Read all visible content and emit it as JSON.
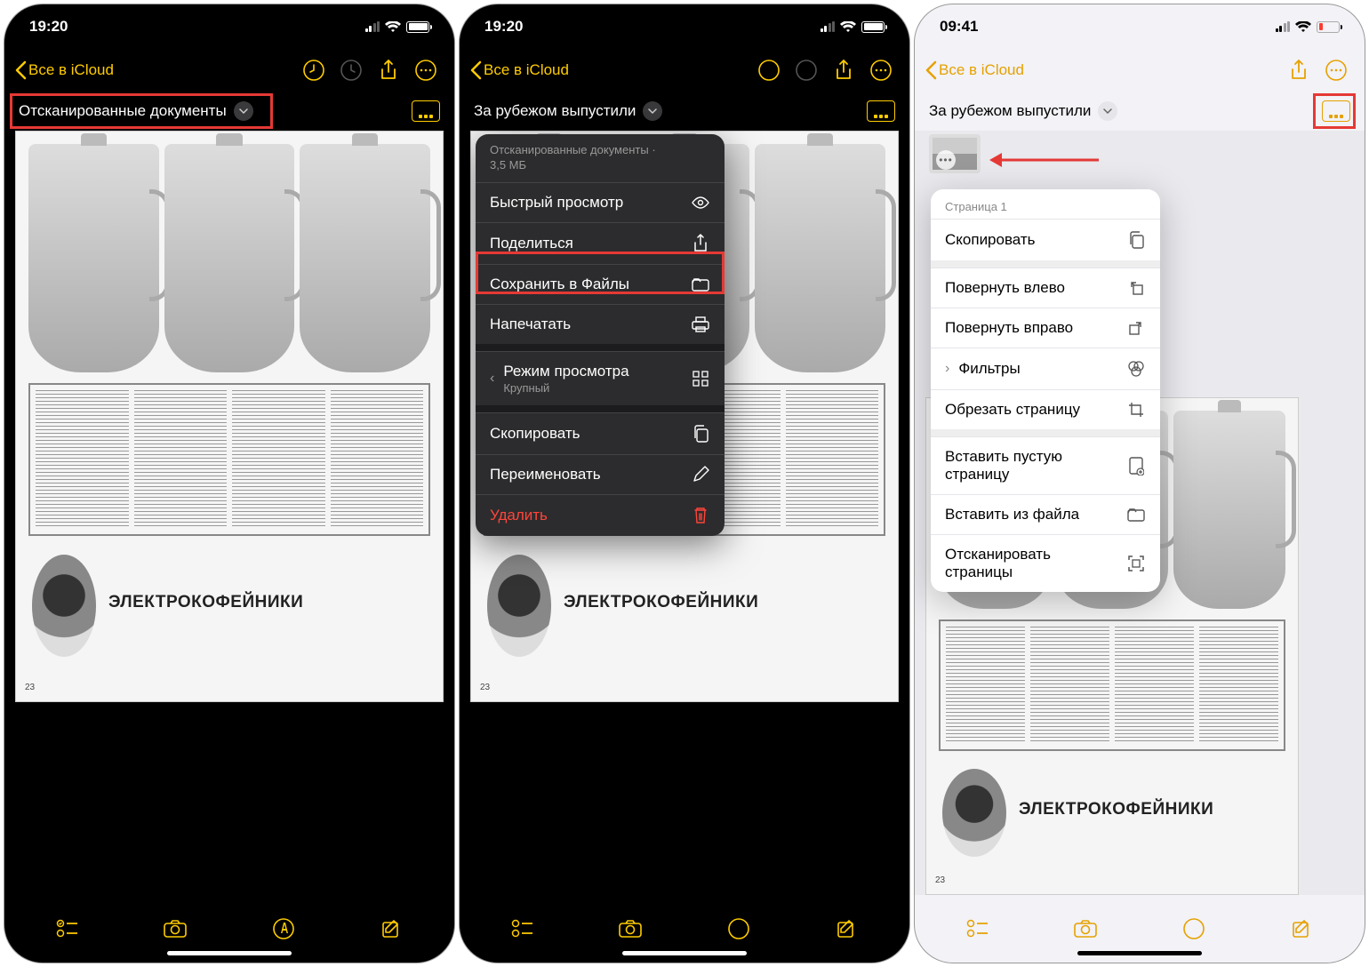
{
  "accent_dark": "#ffcc00",
  "accent_light": "#e6a100",
  "screen1": {
    "time": "19:20",
    "back": "Все в iCloud",
    "title": "Отсканированные документы"
  },
  "screen2": {
    "time": "19:20",
    "back": "Все в iCloud",
    "title": "За рубежом выпустили",
    "menu": {
      "header": "Отсканированные документы ·",
      "size": "3,5 МБ",
      "quicklook": "Быстрый просмотр",
      "share": "Поделиться",
      "save": "Сохранить в Файлы",
      "print": "Напечатать",
      "viewmode": "Режим просмотра",
      "viewmode_sub": "Крупный",
      "copy": "Скопировать",
      "rename": "Переименовать",
      "delete": "Удалить"
    }
  },
  "screen3": {
    "time": "09:41",
    "back": "Все в iCloud",
    "title": "За рубежом выпустили",
    "menu": {
      "header": "Страница 1",
      "copy": "Скопировать",
      "rotleft": "Повернуть влево",
      "rotright": "Повернуть вправо",
      "filters": "Фильтры",
      "crop": "Обрезать страницу",
      "insert_blank": "Вставить пустую страницу",
      "insert_file": "Вставить из файла",
      "scan": "Отсканировать страницы"
    }
  },
  "doc": {
    "brand": "ЭЛЕКТРОКОФЕЙНИКИ",
    "page": "23"
  }
}
